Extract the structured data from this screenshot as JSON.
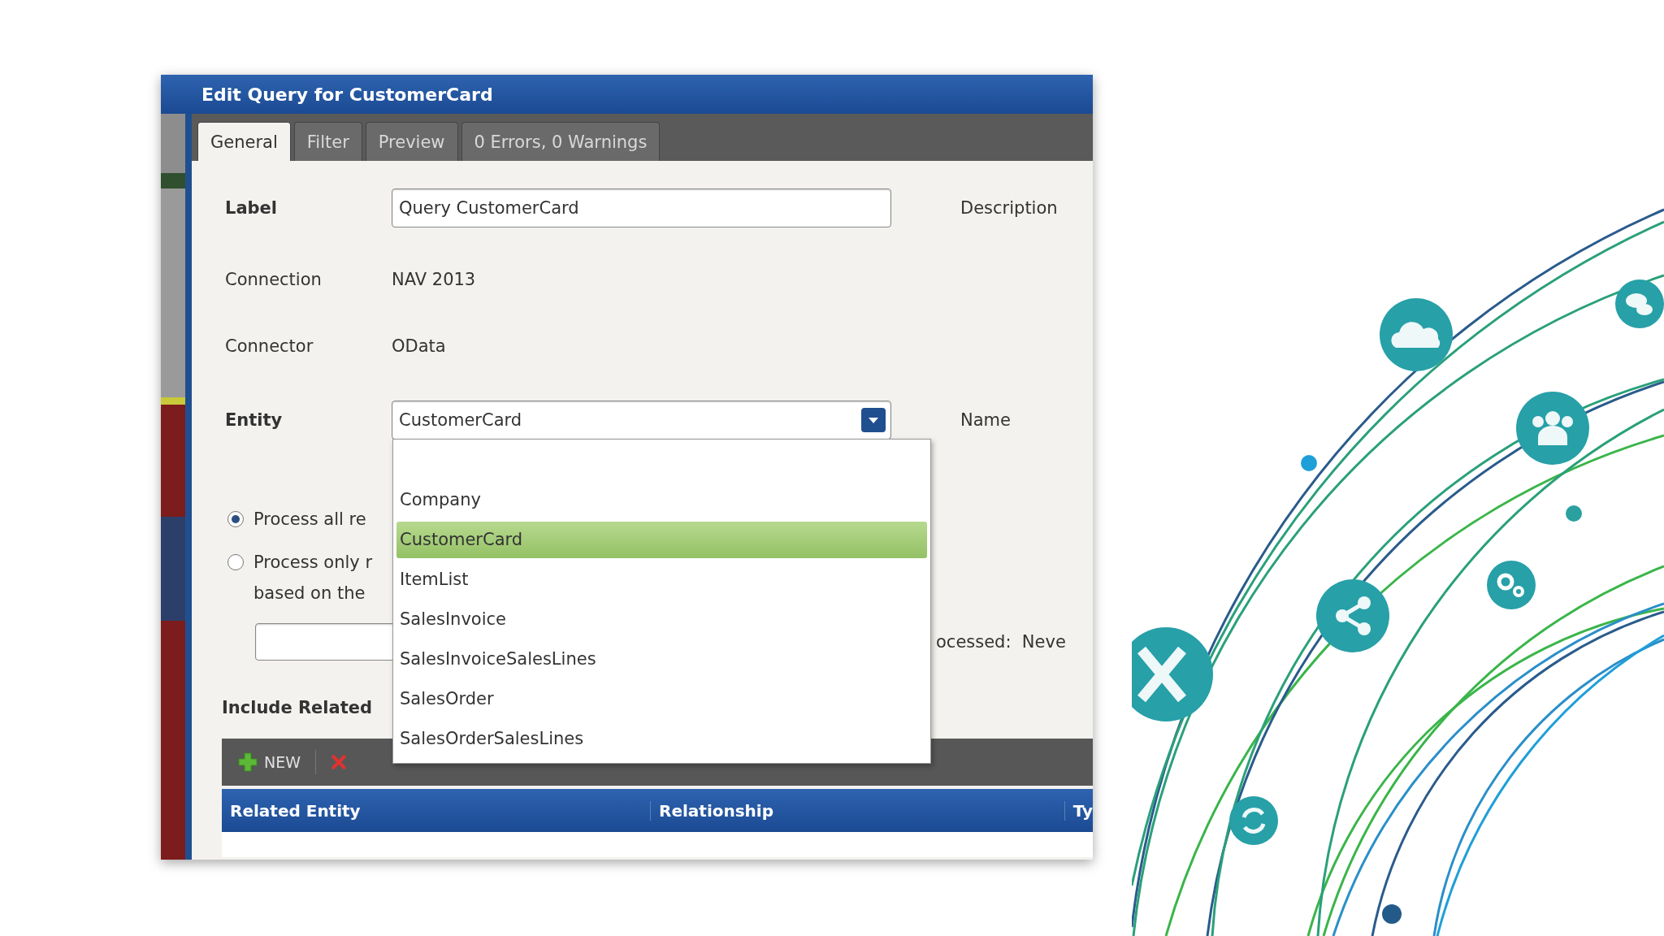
{
  "window": {
    "title": "Edit Query for CustomerCard"
  },
  "tabs": [
    {
      "label": "General",
      "selected": true
    },
    {
      "label": "Filter",
      "selected": false
    },
    {
      "label": "Preview",
      "selected": false
    },
    {
      "label": "0 Errors, 0 Warnings",
      "selected": false
    }
  ],
  "form": {
    "label": {
      "caption": "Label",
      "value": "Query CustomerCard"
    },
    "description": {
      "caption": "Description"
    },
    "connection": {
      "caption": "Connection",
      "value": "NAV 2013"
    },
    "connector": {
      "caption": "Connector",
      "value": "OData"
    },
    "entity": {
      "caption": "Entity",
      "value": "CustomerCard",
      "expanded": true,
      "options": [
        {
          "text": "Company",
          "selected": false
        },
        {
          "text": "CustomerCard",
          "selected": true
        },
        {
          "text": "ItemList",
          "selected": false
        },
        {
          "text": "SalesInvoice",
          "selected": false
        },
        {
          "text": "SalesInvoiceSalesLines",
          "selected": false
        },
        {
          "text": "SalesOrder",
          "selected": false
        },
        {
          "text": "SalesOrderSalesLines",
          "selected": false
        }
      ]
    },
    "name": {
      "caption": "Name"
    }
  },
  "process_options": [
    {
      "lines": [
        "Process all re"
      ],
      "selected": true
    },
    {
      "lines": [
        "Process only r",
        "based on the"
      ],
      "selected": false
    }
  ],
  "last_processed": "ocessed:  Neve",
  "related": {
    "title": "Include Related",
    "new_button": "NEW",
    "columns": [
      "Related Entity",
      "Relationship",
      "Ty"
    ]
  }
}
